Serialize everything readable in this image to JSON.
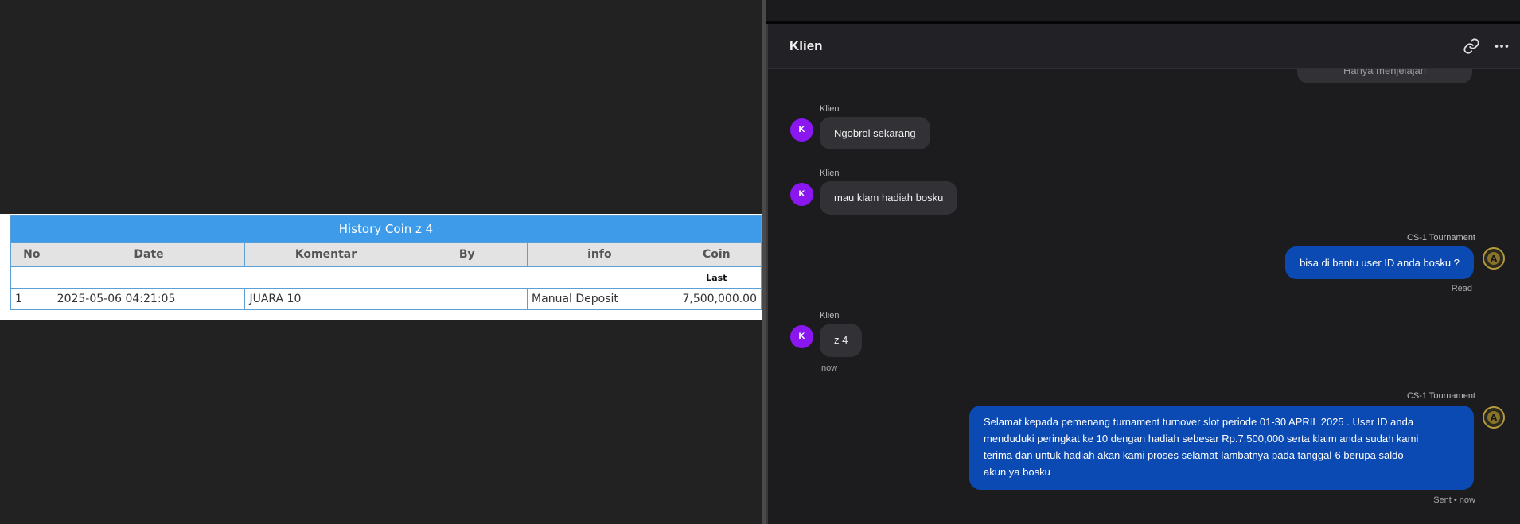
{
  "history": {
    "title": "History Coin z    4",
    "columns": [
      "No",
      "Date",
      "Komentar",
      "By",
      "info",
      "Coin"
    ],
    "sub_header": "Last",
    "rows": [
      {
        "no": "1",
        "date": "2025-05-06 04:21:05",
        "komentar": "JUARA 10",
        "by": "",
        "info": "Manual Deposit",
        "coin": "7,500,000.00"
      }
    ]
  },
  "chat": {
    "title": "Klien",
    "icons": {
      "link": "link-icon",
      "more": "more-horizontal-icon"
    },
    "messages": [
      {
        "dir": "out",
        "text": "Hanya menjelajah"
      },
      {
        "dir": "in",
        "sender": "Klien",
        "avatar": "K",
        "text": "Ngobrol sekarang"
      },
      {
        "dir": "in",
        "sender": "Klien",
        "avatar": "K",
        "text": "mau klam hadiah bosku"
      },
      {
        "dir": "out",
        "sender": "CS-1 Tournament",
        "text": "bisa di bantu user ID anda bosku ?",
        "status": "Read"
      },
      {
        "dir": "in",
        "sender": "Klien",
        "avatar": "K",
        "text": "z    4",
        "time": "now"
      },
      {
        "dir": "out",
        "sender": "CS-1 Tournament",
        "lines": [
          "Selamat kepada pemenang turnament turnover slot periode 01-30 APRIL 2025 . User ID anda",
          "menduduki peringkat ke 10 dengan hadiah sebesar Rp.7,500,000 serta klaim anda sudah kami",
          "terima dan untuk hadiah akan kami proses selamat-lambatnya pada tanggal-6 berupa saldo",
          "akun ya bosku"
        ],
        "status": "Sent • now"
      }
    ],
    "colors": {
      "outgoing": "#0b4ab2",
      "incoming": "#323236",
      "avatar": "#8a17f0"
    }
  }
}
